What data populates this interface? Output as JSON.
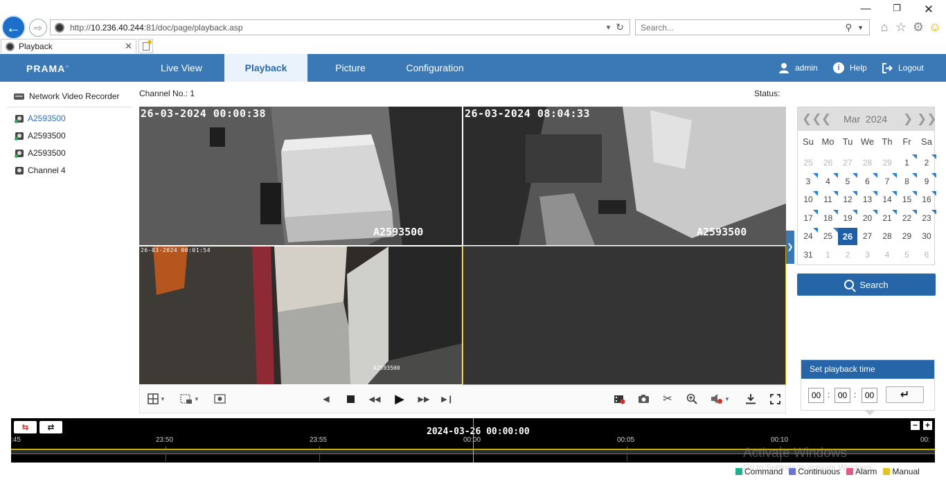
{
  "browser": {
    "url_prefix": "http://",
    "url_host": "10.236.40.244",
    "url_rest": ":81/doc/page/playback.asp",
    "search_placeholder": "Search...",
    "tab_title": "Playback"
  },
  "app": {
    "logo": "PRAMA",
    "nav": [
      "Live View",
      "Playback",
      "Picture",
      "Configuration"
    ],
    "active_tab": "Playback",
    "user": "admin",
    "help": "Help",
    "logout": "Logout"
  },
  "tree": {
    "root": "Network Video Recorder",
    "channels": [
      "A2593500",
      "A2593500",
      "A2593500",
      "Channel 4"
    ]
  },
  "video": {
    "channel_label": "Channel No.: 1",
    "status_label": "Status:",
    "tiles": [
      {
        "timestamp": "26-03-2024 00:00:38",
        "name": "A2593500"
      },
      {
        "timestamp": "26-03-2024 08:04:33",
        "name": "A2593500"
      },
      {
        "timestamp": "26-03-2024 00:01:54",
        "name": "A2593500"
      },
      {
        "timestamp": "",
        "name": ""
      }
    ]
  },
  "calendar": {
    "month": "Mar",
    "year": "2024",
    "days_of_week": [
      "Su",
      "Mo",
      "Tu",
      "We",
      "Th",
      "Fr",
      "Sa"
    ],
    "selected_day": 26,
    "record_days": [
      1,
      2,
      3,
      4,
      5,
      6,
      7,
      8,
      9,
      10,
      11,
      12,
      13,
      14,
      15,
      16,
      17,
      18,
      19,
      20,
      21,
      22,
      23,
      24,
      25
    ],
    "weeks": [
      [
        {
          "d": 25,
          "o": true
        },
        {
          "d": 26,
          "o": true
        },
        {
          "d": 27,
          "o": true
        },
        {
          "d": 28,
          "o": true
        },
        {
          "d": 29,
          "o": true
        },
        {
          "d": 1
        },
        {
          "d": 2
        }
      ],
      [
        {
          "d": 3
        },
        {
          "d": 4
        },
        {
          "d": 5
        },
        {
          "d": 6
        },
        {
          "d": 7
        },
        {
          "d": 8
        },
        {
          "d": 9
        }
      ],
      [
        {
          "d": 10
        },
        {
          "d": 11
        },
        {
          "d": 12
        },
        {
          "d": 13
        },
        {
          "d": 14
        },
        {
          "d": 15
        },
        {
          "d": 16
        }
      ],
      [
        {
          "d": 17
        },
        {
          "d": 18
        },
        {
          "d": 19
        },
        {
          "d": 20
        },
        {
          "d": 21
        },
        {
          "d": 22
        },
        {
          "d": 23
        }
      ],
      [
        {
          "d": 24
        },
        {
          "d": 25
        },
        {
          "d": 26
        },
        {
          "d": 27
        },
        {
          "d": 28
        },
        {
          "d": 29
        },
        {
          "d": 30
        }
      ],
      [
        {
          "d": 31
        },
        {
          "d": 1,
          "o": true
        },
        {
          "d": 2,
          "o": true
        },
        {
          "d": 3,
          "o": true
        },
        {
          "d": 4,
          "o": true
        },
        {
          "d": 5,
          "o": true
        },
        {
          "d": 6,
          "o": true
        }
      ]
    ],
    "search_label": "Search"
  },
  "playback_time": {
    "title": "Set playback time",
    "hh": "00",
    "mm": "00",
    "ss": "00"
  },
  "timeline": {
    "current": "2024-03-26 00:00:00",
    "ticks": [
      ":45",
      "23:50",
      "23:55",
      "00:00",
      "00:05",
      "00:10",
      "00:"
    ]
  },
  "legend": [
    {
      "label": "Command",
      "color": "#20b08a"
    },
    {
      "label": "Continuous",
      "color": "#6a74d9"
    },
    {
      "label": "Alarm",
      "color": "#e05a86"
    },
    {
      "label": "Manual",
      "color": "#e8c21a"
    }
  ],
  "os": {
    "watermark": "Activate Windows",
    "watermark_sub": "Go to Settings to activate Windows."
  },
  "colors": {
    "header_blue": "#3a78b6",
    "primary_button": "#2665a8",
    "selected_day": "#1e5ea6",
    "record_marker": "#2e80d0",
    "active_tile_border": "#d4a800"
  }
}
